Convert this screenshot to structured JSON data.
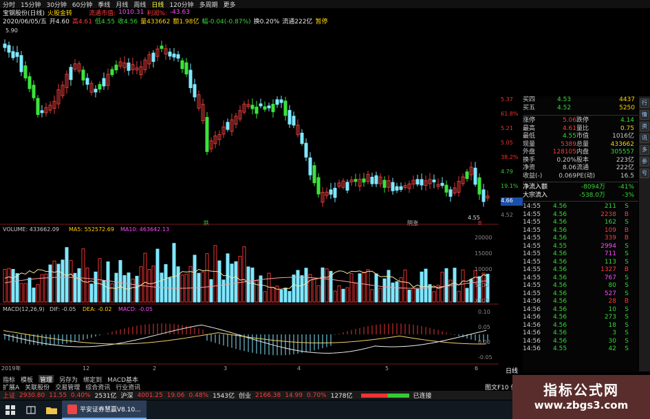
{
  "toolbar": {
    "items": [
      "分时",
      "15分钟",
      "30分钟",
      "60分钟",
      "季线",
      "月线",
      "周线",
      "日线",
      "120分钟",
      "多周期",
      "更多"
    ],
    "active_index": 7
  },
  "info1": {
    "stock": "宝钢股份(日线)",
    "badge": "火股金转",
    "float_label": "流通市值:",
    "float_value": "1010.31",
    "profit_label": "利润%:",
    "profit_value": "-43.63"
  },
  "info2": {
    "date": "2020/06/05/五",
    "open": "开4.60",
    "high": "高4.61",
    "low": "低4.55",
    "close": "收4.56",
    "volume": "量433662",
    "amount": "额1.98亿",
    "change": "幅-0.04(-0.87%)",
    "turnover": "换0.20%",
    "float_shares": "流通222亿",
    "status": "暂停"
  },
  "price_chart": {
    "top_label": "5.90",
    "low_label": "4.55",
    "axis_right": [
      "5.37",
      "61.8%",
      "5.21",
      "5.05",
      "38.2%",
      "4.79",
      "19.1%",
      "4.66",
      "4.52"
    ],
    "current_price": "4.66",
    "marks": [
      "跌",
      "阴涨",
      "B"
    ],
    "colors": {
      "up": "#e23b3b",
      "down_green": "#3be33b",
      "down_cyan": "#7fe8ff"
    }
  },
  "chart_data": {
    "type": "candlestick",
    "volume_label": "VOLUME: 433662.09",
    "ma5_label": "MA5: 552572.69",
    "ma10_label": "MA10: 463642.13",
    "volume_axis": [
      "20000",
      "15000",
      "10000",
      "5000",
      "X100"
    ],
    "macd_label": "MACD(12,26,9)",
    "dif_label": "DIF: -0.05",
    "dea_label": "DEA: -0.02",
    "macd_value_label": "MACD: -0.05",
    "macd_axis": [
      "0.10",
      "0.05",
      "0.00",
      "-0.05"
    ],
    "time_labels": [
      "2019年",
      "12",
      "2",
      "3",
      "4",
      "5",
      "6"
    ]
  },
  "side_panel": {
    "quotes": [
      {
        "label": "买四",
        "v1": "4.53",
        "v2": "4437"
      },
      {
        "label": "买五",
        "v1": "4.52",
        "v2": "5250"
      }
    ],
    "stats": [
      {
        "a": "涨停",
        "av": "5.06",
        "b": "跌停",
        "bv": "4.14"
      },
      {
        "a": "最高",
        "av": "4.61",
        "b": "量比",
        "bv": "0.75"
      },
      {
        "a": "最低",
        "av": "4.55",
        "b": "市值",
        "bv": "1016亿"
      },
      {
        "a": "现量",
        "av": "5389",
        "b": "总量",
        "bv": "433662"
      },
      {
        "a": "外盘",
        "av": "128105",
        "b": "内盘",
        "bv": "305557"
      },
      {
        "a": "换手",
        "av": "0.20%",
        "b": "股本",
        "bv": "223亿"
      },
      {
        "a": "净资",
        "av": "8.06",
        "b": "流通",
        "bv": "222亿"
      },
      {
        "a": "收益(-)",
        "av": "0.069",
        "b": "PE(动)",
        "bv": "16.5"
      }
    ],
    "flows": [
      {
        "label": "净流入额",
        "v1": "-8094万",
        "v2": "-41%"
      },
      {
        "label": "大宗流入",
        "v1": "-538.0万",
        "v2": "-3%"
      }
    ],
    "ticks": [
      {
        "t": "14:55",
        "p": "4.56",
        "v": "211",
        "d": "S"
      },
      {
        "t": "14:55",
        "p": "4.56",
        "v": "2238",
        "d": "B"
      },
      {
        "t": "14:55",
        "p": "4.56",
        "v": "162",
        "d": "S"
      },
      {
        "t": "14:55",
        "p": "4.56",
        "v": "109",
        "d": "B"
      },
      {
        "t": "14:55",
        "p": "4.56",
        "v": "339",
        "d": "B"
      },
      {
        "t": "14:55",
        "p": "4.55",
        "v": "2994",
        "d": "S"
      },
      {
        "t": "14:55",
        "p": "4.56",
        "v": "711",
        "d": "S"
      },
      {
        "t": "14:55",
        "p": "4.56",
        "v": "113",
        "d": "S"
      },
      {
        "t": "14:55",
        "p": "4.56",
        "v": "1327",
        "d": "B"
      },
      {
        "t": "14:55",
        "p": "4.56",
        "v": "767",
        "d": "S"
      },
      {
        "t": "14:55",
        "p": "4.56",
        "v": "80",
        "d": "S"
      },
      {
        "t": "14:55",
        "p": "4.56",
        "v": "527",
        "d": "S"
      },
      {
        "t": "14:56",
        "p": "4.56",
        "v": "28",
        "d": "B"
      },
      {
        "t": "14:56",
        "p": "4.56",
        "v": "10",
        "d": "S"
      },
      {
        "t": "14:56",
        "p": "4.56",
        "v": "273",
        "d": "S"
      },
      {
        "t": "14:56",
        "p": "4.56",
        "v": "18",
        "d": "S"
      },
      {
        "t": "14:56",
        "p": "4.56",
        "v": "3",
        "d": "S"
      },
      {
        "t": "14:56",
        "p": "4.56",
        "v": "30",
        "d": "S"
      },
      {
        "t": "14:56",
        "p": "4.55",
        "v": "42",
        "d": "S"
      }
    ]
  },
  "bottom_tabs": [
    "指标",
    "模板",
    "管理",
    "另存为",
    "绑定到",
    "MACD基本"
  ],
  "bottom_tabs2": [
    "扩展A",
    "关联股份",
    "交易管理",
    "综合资讯",
    "行业资讯"
  ],
  "panel_footer": {
    "left": "图文F10",
    "right": "侧边"
  },
  "daily_btn": "日线",
  "status_bar": {
    "sh": {
      "label": "上证",
      "val": "2930.80",
      "chg": "11.55",
      "pct": "0.40%",
      "amt": "2531亿"
    },
    "sz": {
      "label": "沪深",
      "val": "4001.25",
      "chg": "19.06",
      "pct": "0.48%",
      "amt": "1543亿"
    },
    "cy": {
      "label": "创业",
      "val": "2166.38",
      "chg": "14.99",
      "pct": "0.70%",
      "amt": "1278亿"
    },
    "conn": "已连接"
  },
  "taskbar": {
    "app_label": "平安证券慧赢V8.10..."
  },
  "watermark": {
    "title": "指标公式网",
    "url": "www.zbgs3.com"
  },
  "iconbar": [
    "行",
    "情",
    "资",
    "讯",
    "多",
    "参",
    "号"
  ]
}
